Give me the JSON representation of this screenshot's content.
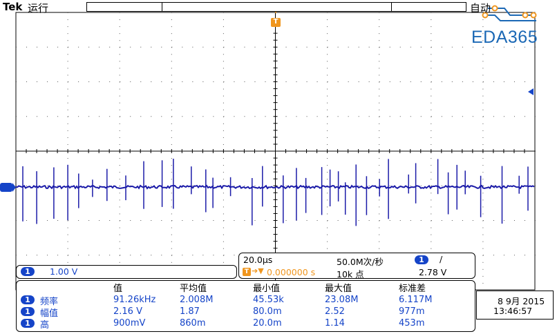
{
  "header": {
    "brand": "Tek",
    "run_state": "运行",
    "trigger_mode": "自动"
  },
  "trigger_marker": {
    "label": "T"
  },
  "logo": {
    "text": "EDA365"
  },
  "channel": {
    "number": "1",
    "scale": "1.00 V",
    "color": "#1a1aa8"
  },
  "timebase": {
    "scale": "20.0µs",
    "sample_rate": "50.0M次/秒",
    "trigger_position": "0.000000 s",
    "record_length": "10k 点",
    "trigger_channel": "1",
    "trigger_slope": "/",
    "trigger_level": "2.78 V"
  },
  "measurements": {
    "headers": [
      "值",
      "平均值",
      "最小值",
      "最大值",
      "标准差"
    ],
    "rows": [
      {
        "channel": "1",
        "name": "频率",
        "values": [
          "91.26kHz",
          "2.008M",
          "45.53k",
          "23.08M",
          "6.117M"
        ]
      },
      {
        "channel": "1",
        "name": "幅值",
        "values": [
          "2.16 V",
          "1.87",
          "80.0m",
          "2.52",
          "977m"
        ]
      },
      {
        "channel": "1",
        "name": "高",
        "values": [
          "900mV",
          "860m",
          "20.0m",
          "1.14",
          "453m"
        ]
      }
    ]
  },
  "datetime": {
    "date": "8 9月 2015",
    "time": "13:46:57"
  }
}
